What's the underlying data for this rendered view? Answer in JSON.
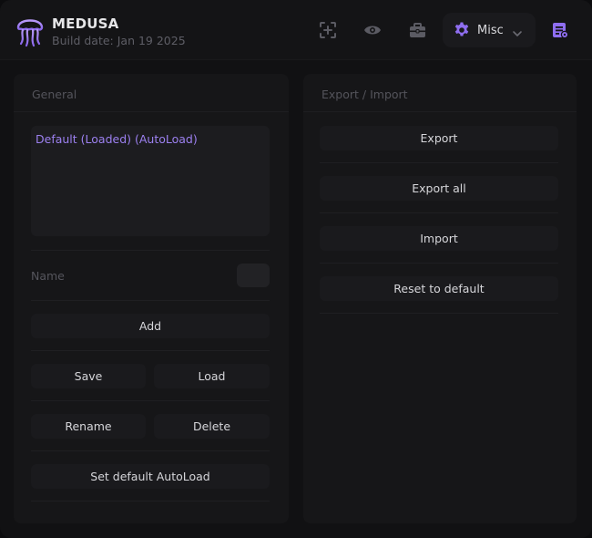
{
  "app": {
    "title": "MEDUSA",
    "build_date": "Build date: Jan 19 2025"
  },
  "header": {
    "icons": [
      "crosshair-icon",
      "eye-icon",
      "briefcase-icon",
      "gear-icon",
      "chevron-down-icon",
      "scripts-icon"
    ],
    "misc_tab_label": "Misc",
    "accent_color": "#8f6ef0"
  },
  "general": {
    "title": "General",
    "configs": [
      "Default (Loaded) (AutoLoad)"
    ],
    "name_label": "Name",
    "name_value": "",
    "add_label": "Add",
    "save_label": "Save",
    "load_label": "Load",
    "rename_label": "Rename",
    "delete_label": "Delete",
    "set_autoload_label": "Set default AutoLoad"
  },
  "export_import": {
    "title": "Export / Import",
    "export_label": "Export",
    "export_all_label": "Export all",
    "import_label": "Import",
    "reset_label": "Reset to default"
  }
}
